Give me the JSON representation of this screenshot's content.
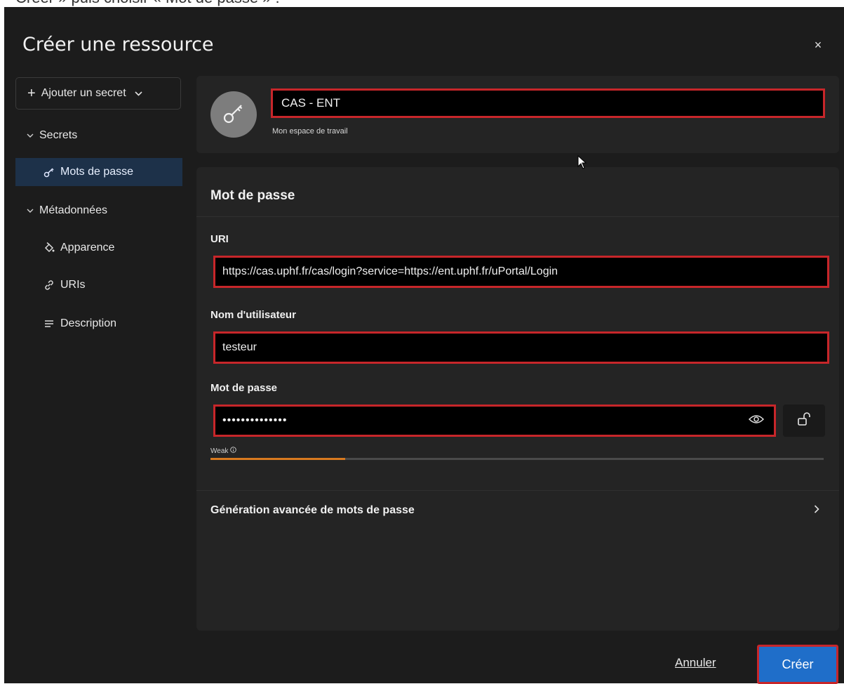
{
  "caption": "Créer » puis choisir « Mot de passe » :",
  "dialog": {
    "title": "Créer une ressource",
    "close_label": "×"
  },
  "sidebar": {
    "add_secret_label": "Ajouter un secret",
    "groups": [
      {
        "label": "Secrets",
        "items": [
          {
            "label": "Mots de passe",
            "icon": "key-icon",
            "active": true
          }
        ]
      },
      {
        "label": "Métadonnées",
        "items": [
          {
            "label": "Apparence",
            "icon": "paint-bucket-icon"
          },
          {
            "label": "URIs",
            "icon": "link-icon"
          },
          {
            "label": "Description",
            "icon": "text-lines-icon"
          }
        ]
      }
    ]
  },
  "resource": {
    "name": "CAS - ENT",
    "workspace": "Mon espace de travail",
    "avatar_icon": "key-icon"
  },
  "password_section": {
    "title": "Mot de passe",
    "uri_label": "URI",
    "uri_value": "https://cas.uphf.fr/cas/login?service=https://ent.uphf.fr/uPortal/Login",
    "username_label": "Nom d'utilisateur",
    "username_value": "testeur",
    "password_label": "Mot de passe",
    "password_value": "••••••••••••••",
    "strength_label": "Weak",
    "strength_fraction": 0.22,
    "advanced_label": "Génération avancée de mots de passe"
  },
  "footer": {
    "cancel_label": "Annuler",
    "create_label": "Créer"
  },
  "colors": {
    "accent": "#1f6ec9",
    "highlight_border": "#c7262a",
    "strength_weak": "#d97a1f",
    "active_nav": "#1d3149"
  }
}
